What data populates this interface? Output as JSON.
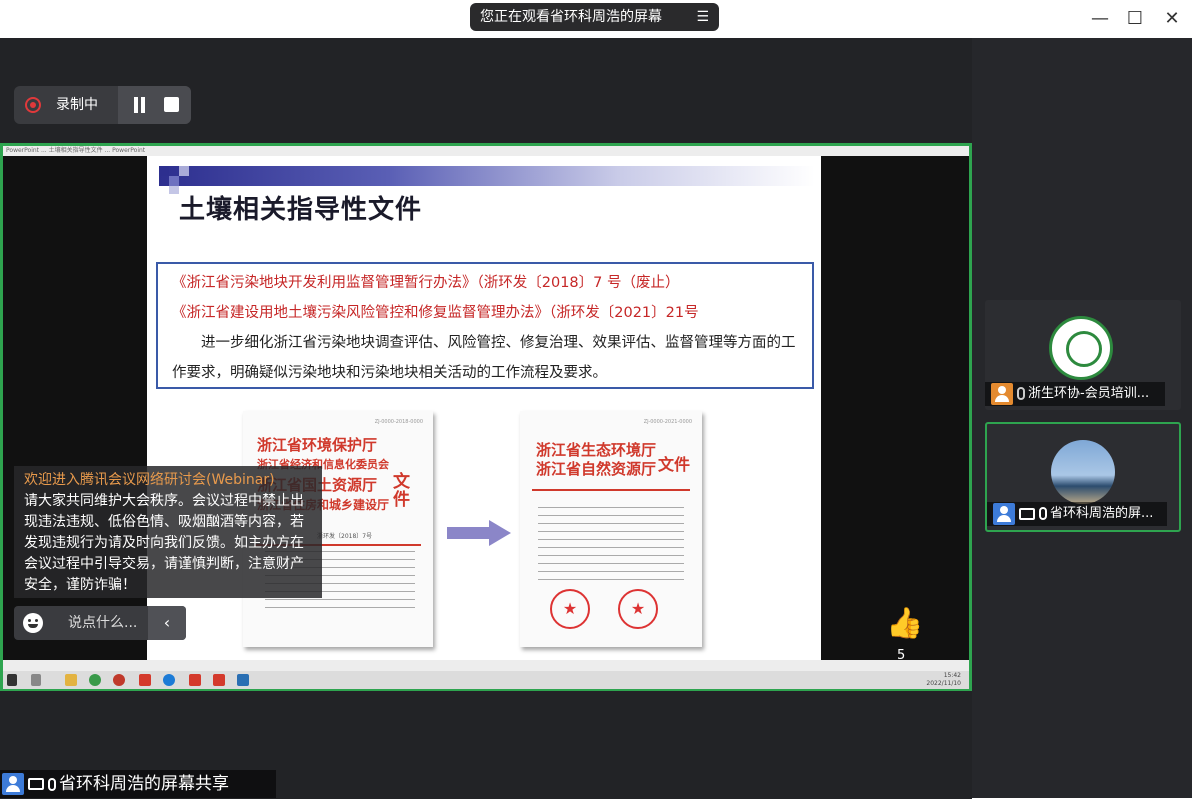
{
  "window": {
    "title": "您正在观看省环科周浩的屏幕",
    "menu_glyph": "☰",
    "minimize_glyph": "—",
    "maximize_glyph": "☐",
    "close_glyph": "✕"
  },
  "recording": {
    "label": "录制中"
  },
  "powerpoint": {
    "titlebar_text": "PowerPoint ...  土壤相关指导性文件 ...  PowerPoint"
  },
  "slide": {
    "title": "土壤相关指导性文件",
    "line1": "《浙江省污染地块开发利用监督管理暂行办法》（浙环发〔2018〕7 号（废止）",
    "line2": "《浙江省建设用地土壤污染风险管控和修复监督管理办法》（浙环发〔2021〕21号",
    "paragraph": "进一步细化浙江省污染地块调查评估、风险管控、修复治理、效果评估、监督管理等方面的工作要求，明确疑似污染地块和污染地块相关活动的工作流程及要求。",
    "doc1": {
      "header_lines": [
        "浙江省环境保护厅",
        "浙江省经济和信息化委员会",
        "浙江省国土资源厅",
        "浙江省住房和城乡建设厅"
      ],
      "header_suffix": "文件",
      "number": "浙环发〔2018〕7号"
    },
    "doc2": {
      "header_lines": [
        "浙江省生态环境厅",
        "浙江省自然资源厅"
      ],
      "header_suffix": "文件"
    }
  },
  "notice": {
    "heading": "欢迎进入腾讯会议网络研讨会(Webinar)",
    "body": "请大家共同维护大会秩序。会议过程中禁止出现违法违规、低俗色情、吸烟酗酒等内容，若发现违规行为请及时向我们反馈。如主办方在会议过程中引导交易，请谨慎判断，注意财产安全，谨防诈骗！"
  },
  "chat": {
    "placeholder": "说点什么..."
  },
  "page_number": "5",
  "participants": [
    {
      "name": "浙生环协-会员培训..."
    },
    {
      "name": "省环科周浩的屏..."
    }
  ],
  "bottom_label": "省环科周浩的屏幕共享",
  "taskbar": {
    "time": "15:42",
    "date": "2022/11/10"
  }
}
